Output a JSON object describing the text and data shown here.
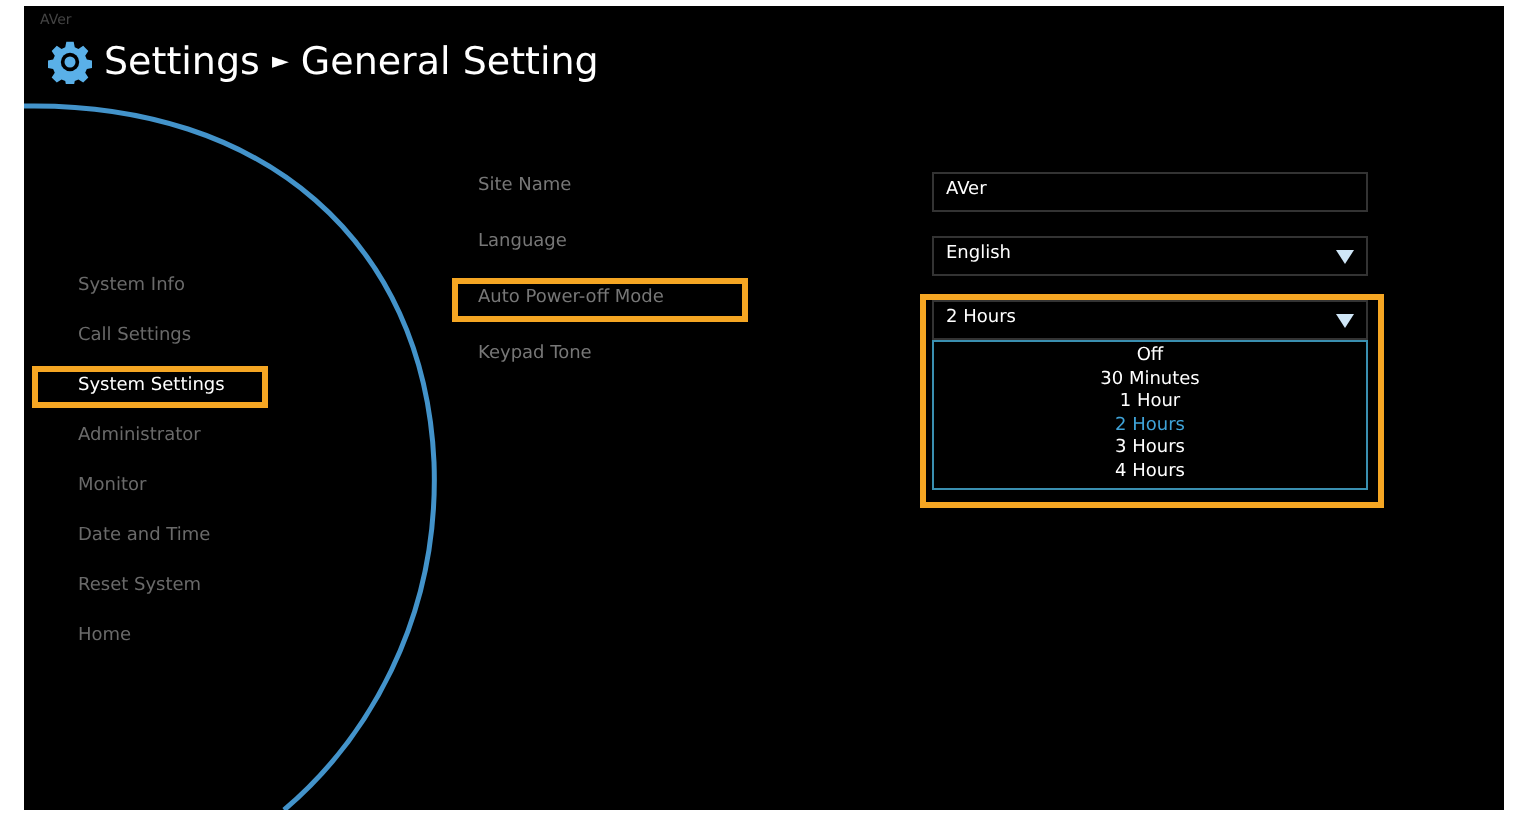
{
  "logo": "AVer",
  "title": {
    "parent": "Settings",
    "separator": "►",
    "current": "General Setting"
  },
  "sidebar": {
    "items": [
      {
        "label": "System Info",
        "selected": false,
        "highlighted": false
      },
      {
        "label": "Call Settings",
        "selected": false,
        "highlighted": false
      },
      {
        "label": "System Settings",
        "selected": true,
        "highlighted": true
      },
      {
        "label": "Administrator",
        "selected": false,
        "highlighted": false
      },
      {
        "label": "Monitor",
        "selected": false,
        "highlighted": false
      },
      {
        "label": "Date and Time",
        "selected": false,
        "highlighted": false
      },
      {
        "label": "Reset System",
        "selected": false,
        "highlighted": false
      },
      {
        "label": "Home",
        "selected": false,
        "highlighted": false
      }
    ]
  },
  "settings": [
    {
      "label": "Site Name",
      "kind": "text",
      "value": "AVer",
      "highlighted": false
    },
    {
      "label": "Language",
      "kind": "dropdown",
      "value": "English",
      "highlighted": false
    },
    {
      "label": "Auto Power-off Mode",
      "kind": "dropdown",
      "value": "2 Hours",
      "highlighted": true,
      "expanded": true,
      "options": [
        {
          "label": "Off",
          "selected": false
        },
        {
          "label": "30 Minutes",
          "selected": false
        },
        {
          "label": "1 Hour",
          "selected": false
        },
        {
          "label": "2 Hours",
          "selected": true
        },
        {
          "label": "3 Hours",
          "selected": false
        },
        {
          "label": "4 Hours",
          "selected": false
        }
      ]
    },
    {
      "label": "Keypad Tone",
      "kind": "none",
      "highlighted": false
    }
  ]
}
